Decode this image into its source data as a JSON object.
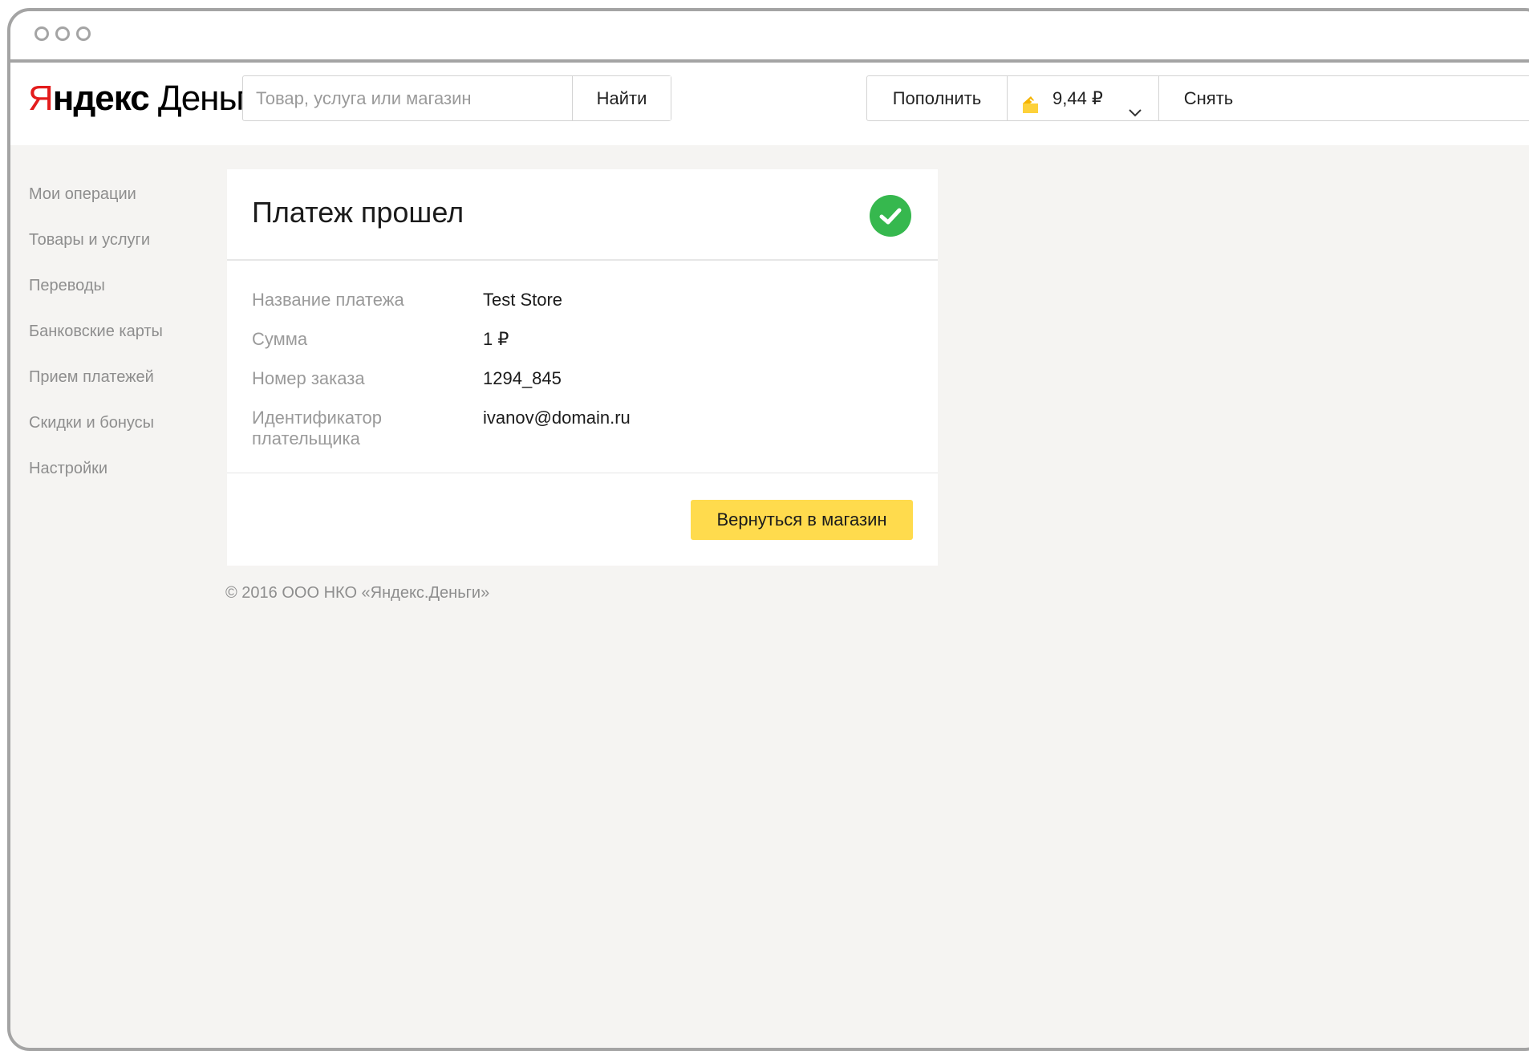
{
  "header": {
    "logo_red": "Я",
    "logo_bold": "ндекс",
    "logo_rest": " Деньги",
    "search": {
      "placeholder": "Товар, услуга или магазин",
      "button": "Найти"
    },
    "topup_label": "Пополнить",
    "balance": "9,44 ₽",
    "withdraw_label": "Снять"
  },
  "sidebar": {
    "items": [
      {
        "label": "Мои операции"
      },
      {
        "label": "Товары и услуги"
      },
      {
        "label": "Переводы"
      },
      {
        "label": "Банковские карты"
      },
      {
        "label": "Прием платежей"
      },
      {
        "label": "Скидки и бонусы"
      },
      {
        "label": "Настройки"
      }
    ]
  },
  "card": {
    "title": "Платеж прошел",
    "rows": [
      {
        "label": "Название платежа",
        "value": "Test Store"
      },
      {
        "label": "Сумма",
        "value": "1 ₽"
      },
      {
        "label": "Номер заказа",
        "value": "1294_845"
      },
      {
        "label": "Идентификатор плательщика",
        "value": "ivanov@domain.ru"
      }
    ],
    "return_button": "Вернуться в магазин"
  },
  "footer": "© 2016 ООО НКО «Яндекс.Деньги»",
  "colors": {
    "accent_yellow": "#ffdb4d",
    "success_green": "#36b84e",
    "logo_red": "#e31c1c"
  }
}
